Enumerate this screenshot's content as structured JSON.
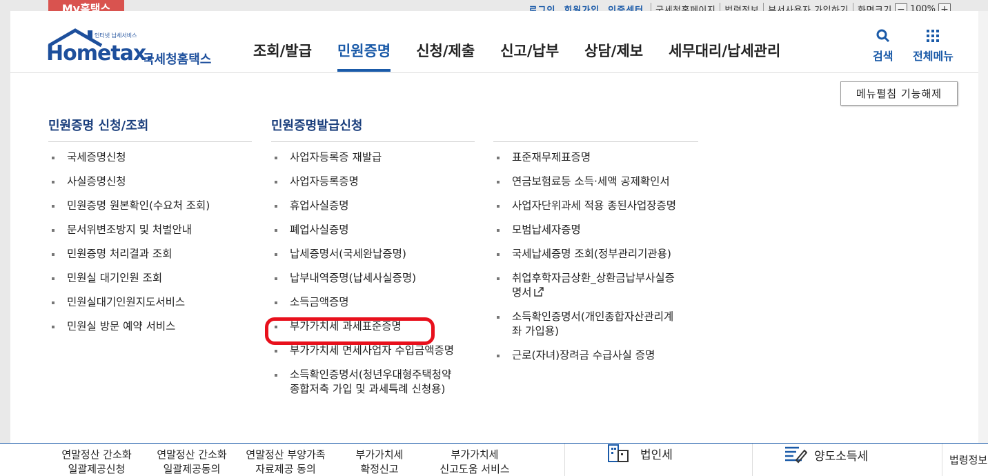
{
  "topbar": {
    "my_tab": "My홈택스",
    "links": [
      "로그인",
      "회원가입",
      "인증센터"
    ],
    "items": [
      "국세청홈페이지",
      "법령정보",
      "부서사용자 가입하기",
      "화면크기"
    ],
    "zoom_minus": "−",
    "zoom_value": "100%",
    "zoom_plus": "+"
  },
  "header": {
    "logo_main": "Hometax.",
    "logo_kr": "국세청홈택스",
    "logo_small": "인터넷 납세서비스",
    "nav": [
      "조회/발급",
      "민원증명",
      "신청/제출",
      "신고/납부",
      "상담/제보",
      "세무대리/납세관리"
    ],
    "active_nav": "민원증명",
    "search_label": "검색",
    "allmenu_label": "전체메뉴"
  },
  "fold_button": "메뉴펼침 기능해제",
  "columns": [
    {
      "title": "민원증명 신청/조회",
      "items": [
        "국세증명신청",
        "사실증명신청",
        "민원증명 원본확인(수요처 조회)",
        "문서위변조방지 및 처벌안내",
        "민원증명 처리결과 조회",
        "민원실 대기인원 조회",
        "민원실대기인원지도서비스",
        "민원실 방문 예약 서비스"
      ]
    },
    {
      "title": "민원증명발급신청",
      "items": [
        "사업자등록증 재발급",
        "사업자등록증명",
        "휴업사실증명",
        "폐업사실증명",
        "납세증명서(국세완납증명)",
        "납부내역증명(납세사실증명)",
        "소득금액증명",
        "부가가치세 과세표준증명",
        "부가가치세 면세사업자 수입금액증명",
        "소득확인증명서(청년우대형주택청약",
        "종합저축 가입 및 과세특례 신청용)"
      ]
    },
    {
      "title": "",
      "items": [
        "표준재무제표증명",
        "연금보험료등 소득·세액 공제확인서",
        "사업자단위과세 적용 종된사업장증명",
        "모범납세자증명",
        "국세납세증명 조회(정부관리기관용)",
        "취업후학자금상환_상환금납부사실증",
        "명서",
        "소득확인증명서(개인종합자산관리계",
        "좌 가입용)",
        "근로(자녀)장려금 수급사실 증명"
      ]
    }
  ],
  "bottom": {
    "items": [
      {
        "line1": "연말정산 간소화",
        "line2": "일괄제공신청"
      },
      {
        "line1": "연말정산 간소화",
        "line2": "일괄제공동의"
      },
      {
        "line1": "연말정산 부양가족",
        "line2": "자료제공 동의"
      },
      {
        "line1": "부가가치세",
        "line2": "확정신고"
      },
      {
        "line1": "부가가치세",
        "line2": "신고도움 서비스"
      }
    ],
    "corp_tax": "법인세",
    "transfer_tax": "양도소득세",
    "law_info": "법령정보"
  }
}
